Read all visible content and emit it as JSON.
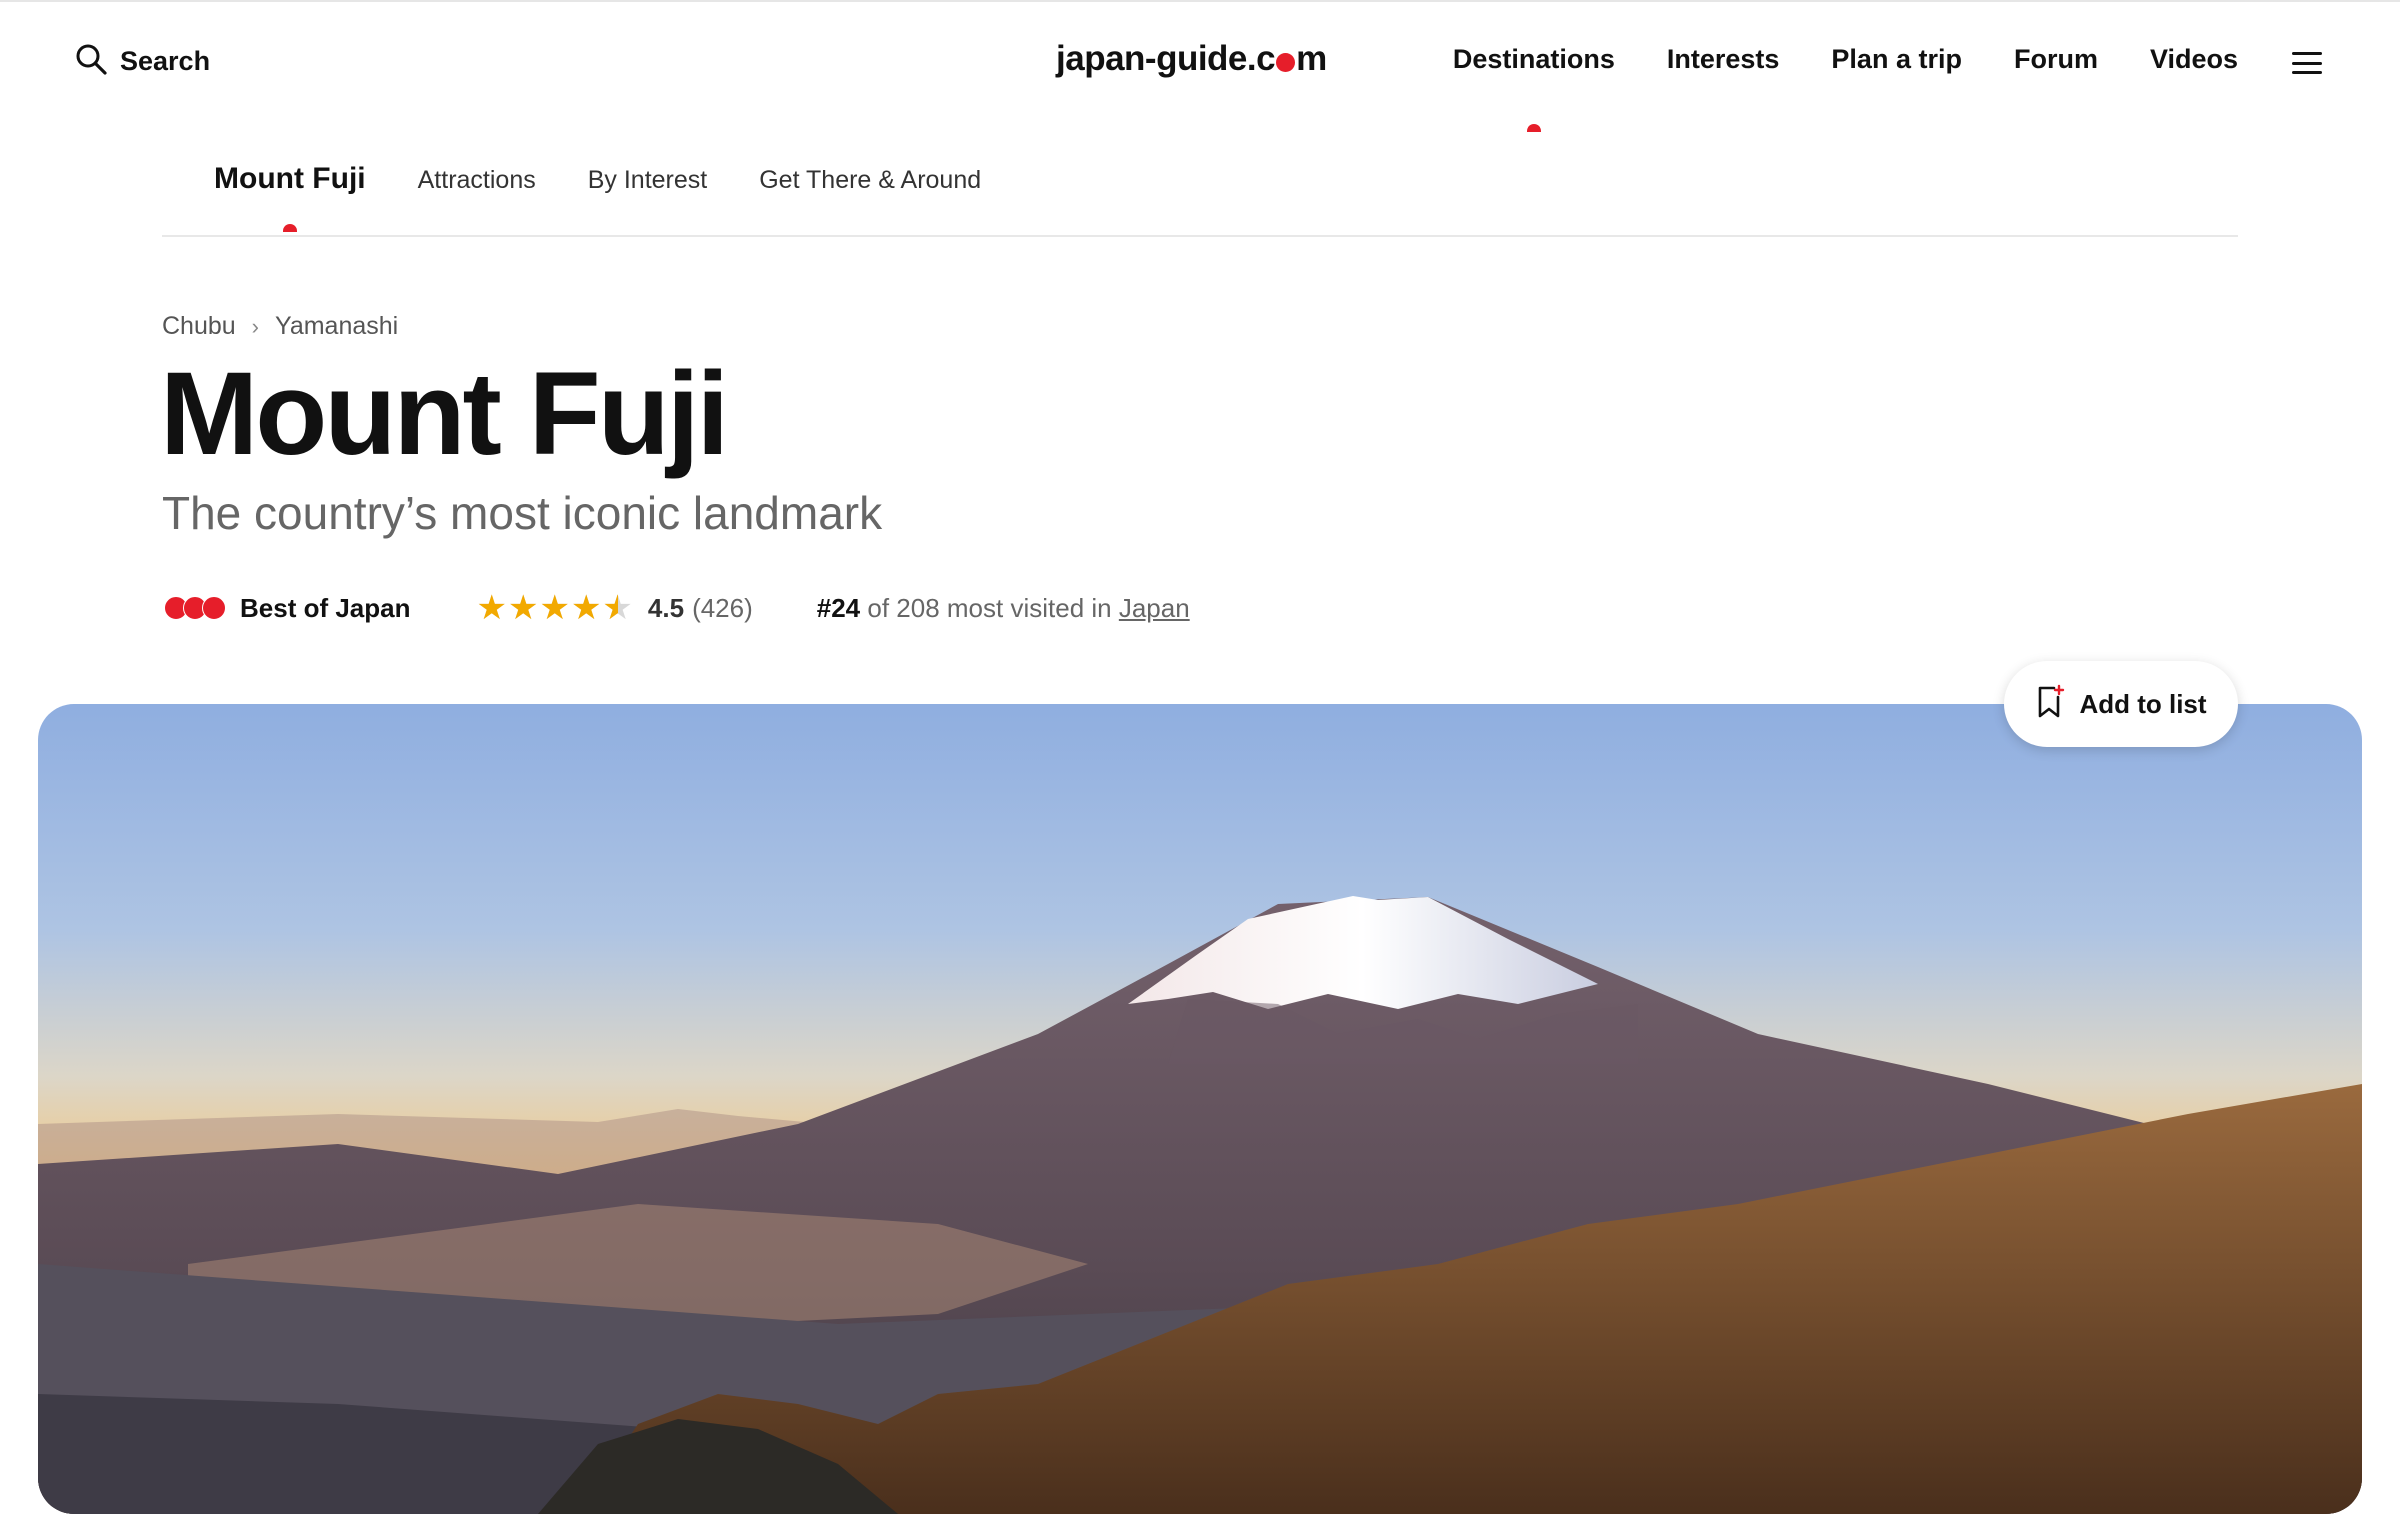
{
  "header": {
    "search_label": "Search",
    "logo": {
      "part1": "japan-guide.c",
      "part2": "m",
      "dot_color": "#e61e2a"
    },
    "nav": [
      "Destinations",
      "Interests",
      "Plan a trip",
      "Forum",
      "Videos"
    ],
    "active_nav": "Destinations"
  },
  "subnav": {
    "items": [
      "Mount Fuji",
      "Attractions",
      "By Interest",
      "Get There & Around"
    ],
    "active": "Mount Fuji"
  },
  "breadcrumb": [
    "Chubu",
    "Yamanashi"
  ],
  "breadcrumb_separator": "›",
  "title": "Mount Fuji",
  "subtitle": "The country’s most iconic landmark",
  "meta": {
    "best_label": "Best of Japan",
    "best_dots": 3,
    "rating": "4.5",
    "rating_value": 4.5,
    "rating_max": 5,
    "rating_count": "(426)",
    "rank_number": "#24",
    "rank_text": " of 208 most visited in ",
    "rank_link": "Japan"
  },
  "hero": {
    "add_to_list_label": "Add to list"
  },
  "icons": {
    "search": "search-icon",
    "menu": "hamburger-menu-icon",
    "bookmark": "bookmark-add-icon",
    "star": "star-icon",
    "best_dots": "red-dots-icon"
  },
  "colors": {
    "accent": "#e61e2a",
    "star": "#f2a900",
    "text": "#111111",
    "muted": "#666666"
  }
}
